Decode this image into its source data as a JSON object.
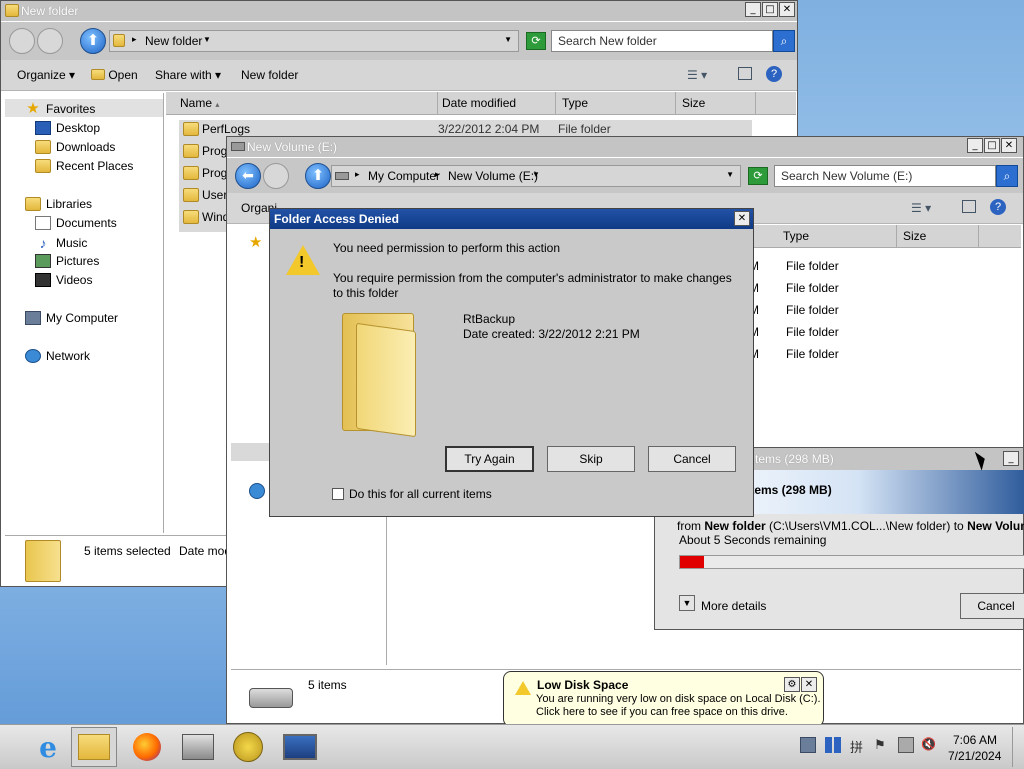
{
  "win1": {
    "title": "New folder",
    "address": "New folder",
    "search_placeholder": "Search New folder",
    "toolbar": {
      "organize": "Organize",
      "open": "Open",
      "share_with": "Share with",
      "new_folder": "New folder"
    },
    "nav": {
      "favorites": "Favorites",
      "desktop": "Desktop",
      "downloads": "Downloads",
      "recent": "Recent Places",
      "libraries": "Libraries",
      "documents": "Documents",
      "music": "Music",
      "pictures": "Pictures",
      "videos": "Videos",
      "computer": "My Computer",
      "network": "Network"
    },
    "columns": {
      "name": "Name",
      "date": "Date modified",
      "type": "Type",
      "size": "Size"
    },
    "rows": [
      {
        "name": "PerfLogs",
        "date": "3/22/2012 2:04 PM",
        "type": "File folder"
      },
      {
        "name": "Progr"
      },
      {
        "name": "Progr"
      },
      {
        "name": "Users"
      },
      {
        "name": "Windo"
      }
    ],
    "status": {
      "selected": "5 items selected",
      "date_mod": "Date mod"
    }
  },
  "win2": {
    "title": "New Volume (E:)",
    "crumb1": "My Computer",
    "crumb2": "New Volume (E:)",
    "search_placeholder": "Search New Volume (E:)",
    "toolbar_partial": "Organi",
    "toolbar_partial2": "...",
    "columns": {
      "type": "Type",
      "size": "Size"
    },
    "rows_date_frag": "M",
    "rows_type": [
      "File folder",
      "File folder",
      "File folder",
      "File folder",
      "File folder"
    ],
    "status_items": "5 items"
  },
  "copy": {
    "title": "...tems (298 MB)",
    "heading": "Items (298 MB)",
    "from_prefix": "from ",
    "from_src": "New folder",
    "from_path": " (C:\\Users\\VM1.COL...\\New folder) to ",
    "from_dst": "New Volume (E",
    "remaining": "About 5 Seconds remaining",
    "progress": 0.07,
    "more_details": "More details",
    "cancel": "Cancel"
  },
  "dialog": {
    "title": "Folder Access Denied",
    "line1": "You need permission to perform this action",
    "line2": "You require permission from the computer's administrator to make changes to this folder",
    "item_name": "RtBackup",
    "item_date": "Date created: 3/22/2012 2:21 PM",
    "btn_try": "Try Again",
    "btn_skip": "Skip",
    "btn_cancel": "Cancel",
    "checkbox_label": "Do this for all current items",
    "checkbox_checked": false
  },
  "balloon": {
    "title": "Low Disk Space",
    "line1": "You are running very low on disk space on Local Disk (C:).",
    "line2": "Click here to see if you can free space on this drive."
  },
  "taskbar": {
    "time": "7:06 AM",
    "date": "7/21/2024"
  }
}
